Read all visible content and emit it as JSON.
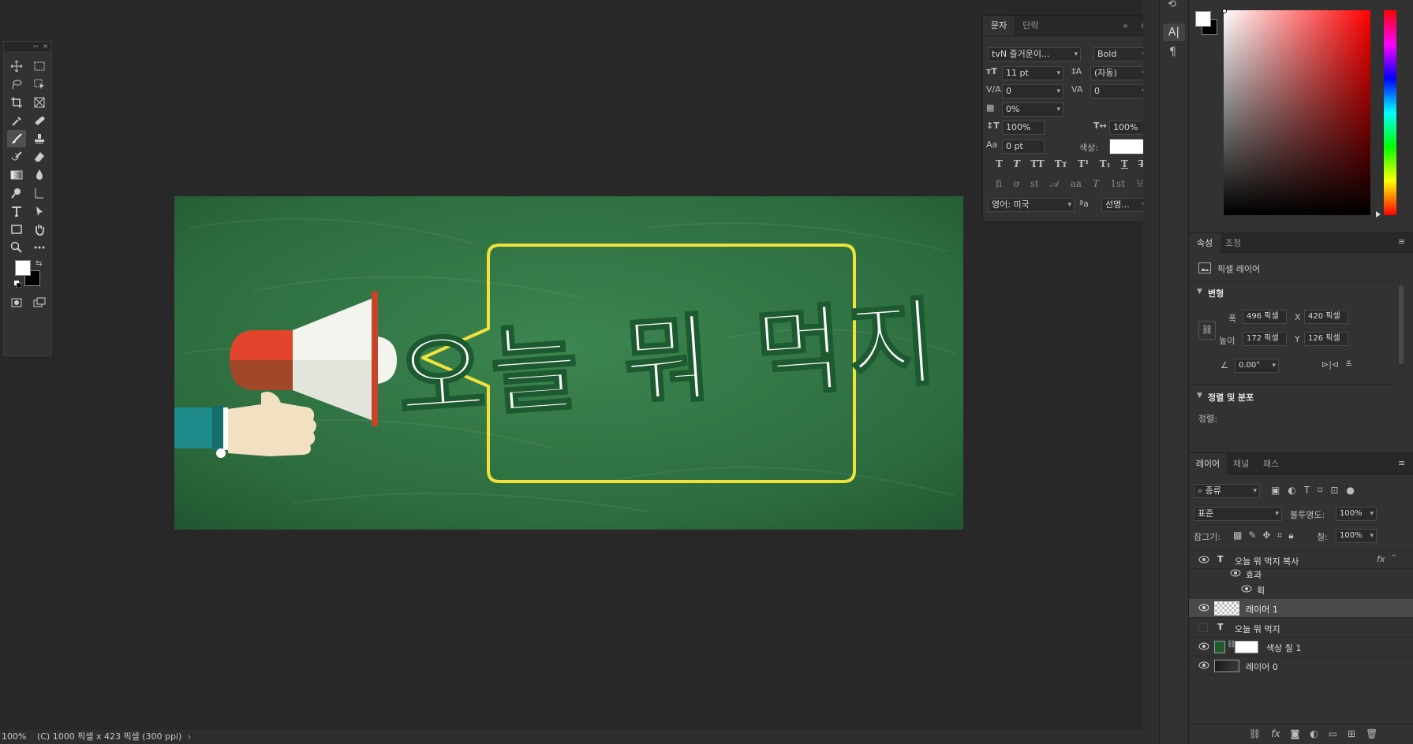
{
  "tools_panel": {
    "collapse": "‹‹",
    "close": "×"
  },
  "character_panel": {
    "tabs": [
      "문자",
      "단락"
    ],
    "font_family": "tvN 즐거운이...",
    "font_style": "Bold",
    "font_size": "11 pt",
    "leading": "(자동)",
    "kerning": "0",
    "tracking": "0",
    "tsume": "0%",
    "vertical_scale": "100%",
    "horizontal_scale": "100%",
    "baseline_shift": "0 pt",
    "color_label": "색상:",
    "text_color": "#ffffff",
    "language": "영어: 미국",
    "antialias": "선명..."
  },
  "canvas": {
    "headline": "오늘 뭐 먹지",
    "board_color": "#2a6a3c",
    "bubble_color": "#f0e23a"
  },
  "properties_panel": {
    "tabs": [
      "속성",
      "조정"
    ],
    "layer_type": "픽셀 레이어",
    "transform_title": "변형",
    "width_label": "폭",
    "width": "496 픽셀",
    "height_label": "높이",
    "height": "172 픽셀",
    "x_label": "X",
    "x": "420 픽셀",
    "y_label": "Y",
    "y": "126 픽셀",
    "angle": "0.00°",
    "align_title": "정렬 및 분포",
    "align_label": "정렬:"
  },
  "layers_panel": {
    "tabs": [
      "레이어",
      "채널",
      "패스"
    ],
    "filter": "종류",
    "blend_mode": "표준",
    "opacity_label": "불투명도:",
    "opacity": "100%",
    "lock_label": "잠그기:",
    "fill_label": "칠:",
    "fill": "100%",
    "layers": [
      {
        "name": "오늘 뭐 먹지 복사",
        "kind": "text",
        "visible": true
      },
      {
        "name": "효과",
        "kind": "effects",
        "visible": true
      },
      {
        "name": "획",
        "kind": "effect",
        "visible": true
      },
      {
        "name": "레이어 1",
        "kind": "pixel",
        "visible": true,
        "selected": true
      },
      {
        "name": "오늘 뭐 먹지",
        "kind": "text",
        "visible": false
      },
      {
        "name": "색상 칠 1",
        "kind": "fill",
        "visible": true
      },
      {
        "name": "레이어 0",
        "kind": "pixel",
        "visible": true
      }
    ]
  },
  "status_bar": {
    "zoom": "100%",
    "doc_info": "(C) 1000 픽셀 x 423 픽셀 (300 ppi)"
  }
}
